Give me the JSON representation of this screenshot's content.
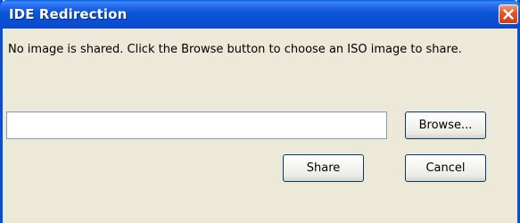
{
  "window": {
    "title": "IDE Redirection"
  },
  "message": "No image is shared. Click the Browse button to choose an ISO image to share.",
  "image_path": {
    "value": "",
    "placeholder": ""
  },
  "buttons": {
    "browse": "Browse...",
    "share": "Share",
    "cancel": "Cancel"
  },
  "colors": {
    "titlebar": "#0a55d8",
    "close_button": "#e0582c",
    "dialog_background": "#ece9d8"
  }
}
